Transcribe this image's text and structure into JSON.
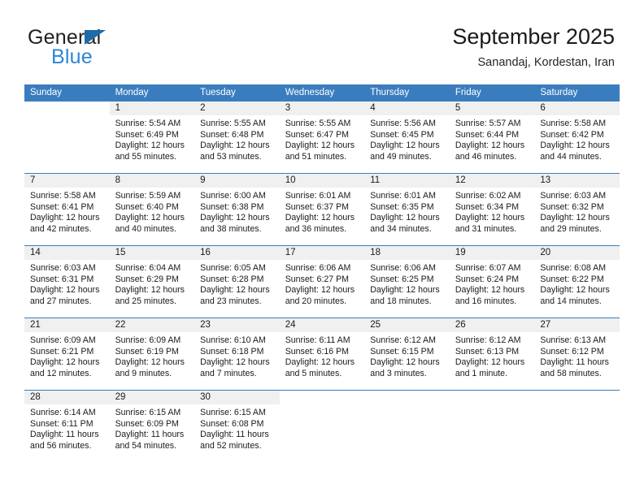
{
  "brand": {
    "name_top": "General",
    "name_bottom": "Blue",
    "accent_color": "#2e86d4",
    "triangle_color": "#1b6ca8"
  },
  "header": {
    "title": "September 2025",
    "subtitle": "Sanandaj, Kordestan, Iran",
    "header_bg": "#3a7dbf",
    "daynum_bg": "#f0f0f0"
  },
  "weekday_headers": [
    "Sunday",
    "Monday",
    "Tuesday",
    "Wednesday",
    "Thursday",
    "Friday",
    "Saturday"
  ],
  "labels": {
    "sunrise": "Sunrise:",
    "sunset": "Sunset:",
    "daylight": "Daylight:"
  },
  "weeks": [
    [
      {
        "day": "",
        "sunrise": "",
        "sunset": "",
        "daylight1": "",
        "daylight2": "",
        "blank": true
      },
      {
        "day": "1",
        "sunrise": "Sunrise: 5:54 AM",
        "sunset": "Sunset: 6:49 PM",
        "daylight1": "Daylight: 12 hours",
        "daylight2": "and 55 minutes."
      },
      {
        "day": "2",
        "sunrise": "Sunrise: 5:55 AM",
        "sunset": "Sunset: 6:48 PM",
        "daylight1": "Daylight: 12 hours",
        "daylight2": "and 53 minutes."
      },
      {
        "day": "3",
        "sunrise": "Sunrise: 5:55 AM",
        "sunset": "Sunset: 6:47 PM",
        "daylight1": "Daylight: 12 hours",
        "daylight2": "and 51 minutes."
      },
      {
        "day": "4",
        "sunrise": "Sunrise: 5:56 AM",
        "sunset": "Sunset: 6:45 PM",
        "daylight1": "Daylight: 12 hours",
        "daylight2": "and 49 minutes."
      },
      {
        "day": "5",
        "sunrise": "Sunrise: 5:57 AM",
        "sunset": "Sunset: 6:44 PM",
        "daylight1": "Daylight: 12 hours",
        "daylight2": "and 46 minutes."
      },
      {
        "day": "6",
        "sunrise": "Sunrise: 5:58 AM",
        "sunset": "Sunset: 6:42 PM",
        "daylight1": "Daylight: 12 hours",
        "daylight2": "and 44 minutes."
      }
    ],
    [
      {
        "day": "7",
        "sunrise": "Sunrise: 5:58 AM",
        "sunset": "Sunset: 6:41 PM",
        "daylight1": "Daylight: 12 hours",
        "daylight2": "and 42 minutes."
      },
      {
        "day": "8",
        "sunrise": "Sunrise: 5:59 AM",
        "sunset": "Sunset: 6:40 PM",
        "daylight1": "Daylight: 12 hours",
        "daylight2": "and 40 minutes."
      },
      {
        "day": "9",
        "sunrise": "Sunrise: 6:00 AM",
        "sunset": "Sunset: 6:38 PM",
        "daylight1": "Daylight: 12 hours",
        "daylight2": "and 38 minutes."
      },
      {
        "day": "10",
        "sunrise": "Sunrise: 6:01 AM",
        "sunset": "Sunset: 6:37 PM",
        "daylight1": "Daylight: 12 hours",
        "daylight2": "and 36 minutes."
      },
      {
        "day": "11",
        "sunrise": "Sunrise: 6:01 AM",
        "sunset": "Sunset: 6:35 PM",
        "daylight1": "Daylight: 12 hours",
        "daylight2": "and 34 minutes."
      },
      {
        "day": "12",
        "sunrise": "Sunrise: 6:02 AM",
        "sunset": "Sunset: 6:34 PM",
        "daylight1": "Daylight: 12 hours",
        "daylight2": "and 31 minutes."
      },
      {
        "day": "13",
        "sunrise": "Sunrise: 6:03 AM",
        "sunset": "Sunset: 6:32 PM",
        "daylight1": "Daylight: 12 hours",
        "daylight2": "and 29 minutes."
      }
    ],
    [
      {
        "day": "14",
        "sunrise": "Sunrise: 6:03 AM",
        "sunset": "Sunset: 6:31 PM",
        "daylight1": "Daylight: 12 hours",
        "daylight2": "and 27 minutes."
      },
      {
        "day": "15",
        "sunrise": "Sunrise: 6:04 AM",
        "sunset": "Sunset: 6:29 PM",
        "daylight1": "Daylight: 12 hours",
        "daylight2": "and 25 minutes."
      },
      {
        "day": "16",
        "sunrise": "Sunrise: 6:05 AM",
        "sunset": "Sunset: 6:28 PM",
        "daylight1": "Daylight: 12 hours",
        "daylight2": "and 23 minutes."
      },
      {
        "day": "17",
        "sunrise": "Sunrise: 6:06 AM",
        "sunset": "Sunset: 6:27 PM",
        "daylight1": "Daylight: 12 hours",
        "daylight2": "and 20 minutes."
      },
      {
        "day": "18",
        "sunrise": "Sunrise: 6:06 AM",
        "sunset": "Sunset: 6:25 PM",
        "daylight1": "Daylight: 12 hours",
        "daylight2": "and 18 minutes."
      },
      {
        "day": "19",
        "sunrise": "Sunrise: 6:07 AM",
        "sunset": "Sunset: 6:24 PM",
        "daylight1": "Daylight: 12 hours",
        "daylight2": "and 16 minutes."
      },
      {
        "day": "20",
        "sunrise": "Sunrise: 6:08 AM",
        "sunset": "Sunset: 6:22 PM",
        "daylight1": "Daylight: 12 hours",
        "daylight2": "and 14 minutes."
      }
    ],
    [
      {
        "day": "21",
        "sunrise": "Sunrise: 6:09 AM",
        "sunset": "Sunset: 6:21 PM",
        "daylight1": "Daylight: 12 hours",
        "daylight2": "and 12 minutes."
      },
      {
        "day": "22",
        "sunrise": "Sunrise: 6:09 AM",
        "sunset": "Sunset: 6:19 PM",
        "daylight1": "Daylight: 12 hours",
        "daylight2": "and 9 minutes."
      },
      {
        "day": "23",
        "sunrise": "Sunrise: 6:10 AM",
        "sunset": "Sunset: 6:18 PM",
        "daylight1": "Daylight: 12 hours",
        "daylight2": "and 7 minutes."
      },
      {
        "day": "24",
        "sunrise": "Sunrise: 6:11 AM",
        "sunset": "Sunset: 6:16 PM",
        "daylight1": "Daylight: 12 hours",
        "daylight2": "and 5 minutes."
      },
      {
        "day": "25",
        "sunrise": "Sunrise: 6:12 AM",
        "sunset": "Sunset: 6:15 PM",
        "daylight1": "Daylight: 12 hours",
        "daylight2": "and 3 minutes."
      },
      {
        "day": "26",
        "sunrise": "Sunrise: 6:12 AM",
        "sunset": "Sunset: 6:13 PM",
        "daylight1": "Daylight: 12 hours",
        "daylight2": "and 1 minute."
      },
      {
        "day": "27",
        "sunrise": "Sunrise: 6:13 AM",
        "sunset": "Sunset: 6:12 PM",
        "daylight1": "Daylight: 11 hours",
        "daylight2": "and 58 minutes."
      }
    ],
    [
      {
        "day": "28",
        "sunrise": "Sunrise: 6:14 AM",
        "sunset": "Sunset: 6:11 PM",
        "daylight1": "Daylight: 11 hours",
        "daylight2": "and 56 minutes."
      },
      {
        "day": "29",
        "sunrise": "Sunrise: 6:15 AM",
        "sunset": "Sunset: 6:09 PM",
        "daylight1": "Daylight: 11 hours",
        "daylight2": "and 54 minutes."
      },
      {
        "day": "30",
        "sunrise": "Sunrise: 6:15 AM",
        "sunset": "Sunset: 6:08 PM",
        "daylight1": "Daylight: 11 hours",
        "daylight2": "and 52 minutes."
      },
      {
        "day": "",
        "sunrise": "",
        "sunset": "",
        "daylight1": "",
        "daylight2": "",
        "blank": true
      },
      {
        "day": "",
        "sunrise": "",
        "sunset": "",
        "daylight1": "",
        "daylight2": "",
        "blank": true
      },
      {
        "day": "",
        "sunrise": "",
        "sunset": "",
        "daylight1": "",
        "daylight2": "",
        "blank": true
      },
      {
        "day": "",
        "sunrise": "",
        "sunset": "",
        "daylight1": "",
        "daylight2": "",
        "blank": true
      }
    ]
  ]
}
